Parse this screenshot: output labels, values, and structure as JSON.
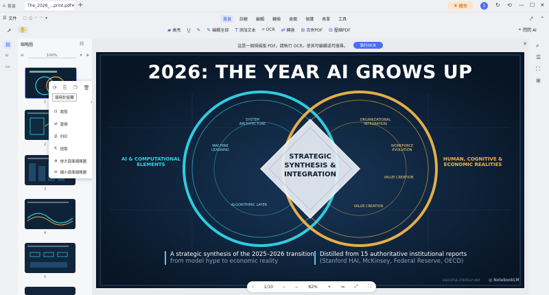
{
  "titlebar": {
    "home_label": "首頁",
    "tab_label": "The_2026_...print.pdf",
    "upgrade_label": "購買",
    "avatar_letter": "1"
  },
  "menubar": {
    "file_label": "文件",
    "items": [
      "首頁",
      "註解",
      "編輯",
      "轉換",
      "頁面",
      "保護",
      "表單",
      "工具"
    ],
    "active_index": 0
  },
  "toolbar": {
    "tools": [
      {
        "icon": "highlight-icon",
        "label": "高亮"
      },
      {
        "icon": "underline-icon",
        "label": ""
      },
      {
        "icon": "pen-icon",
        "label": ""
      },
      {
        "icon": "edit-all-icon",
        "label": "編輯全部"
      },
      {
        "icon": "add-text-icon",
        "label": "添加文本"
      },
      {
        "icon": "ocr-icon",
        "label": "OCR"
      },
      {
        "icon": "convert-icon",
        "label": "轉換"
      },
      {
        "icon": "merge-icon",
        "label": "合併PDF"
      },
      {
        "icon": "compress-icon",
        "label": "壓縮PDF"
      }
    ],
    "ai_label": "問問 AI"
  },
  "sidebar": {
    "title": "縮略圖",
    "zoom_value": "100%",
    "page_numbers": [
      "1",
      "2",
      "3",
      "4",
      "5"
    ]
  },
  "context_menu": {
    "tooltip": "順時針旋轉",
    "items": [
      "裁剪",
      "替換",
      "列印",
      "提取",
      "放大頁面縮略圖",
      "縮小頁面縮略圖"
    ]
  },
  "banner": {
    "message": "這是一個掃描版 PDF。請執行 OCR，使其可編輯或可搜尋。",
    "button_label": "執行OCR"
  },
  "slide": {
    "title": "2026: THE YEAR AI GROWS UP",
    "left_heading": "AI & COMPUTATIONAL ELEMENTS",
    "right_heading": "HUMAN, COGNITIVE & ECONOMIC REALITIES",
    "center_text": "STRATEGIC SYNTHESIS & INTEGRATION",
    "left_labels": [
      "SYSTEM ARCHITECTURE",
      "MACHINE LEARNING",
      "ALGORITHMIC LAYER"
    ],
    "right_labels": [
      "ORGANIZATIONAL INTEGRATION",
      "WORKFORCE EVOLUTION",
      "VALUE CREATION",
      "VALUE CREATION"
    ],
    "bottom_left_line1": "A strategic synthesis of the 2025–2026 transition",
    "bottom_left_line2": "from model hype to economic reality",
    "bottom_right_line1": "Distilled from 15 authoritative institutional reports",
    "bottom_right_line2": "(Stanford HAI, McKinsey, Federal Reserve, OECD)",
    "footer_small": "EXECUTIVE STRATEGY UNIT",
    "brand": "NotebookLM",
    "colors": {
      "cyan": "#2fd6e8",
      "gold": "#f0b54a",
      "bg": "#0b1a2c"
    }
  },
  "pagebar": {
    "page": "1/10",
    "zoom": "82%"
  }
}
